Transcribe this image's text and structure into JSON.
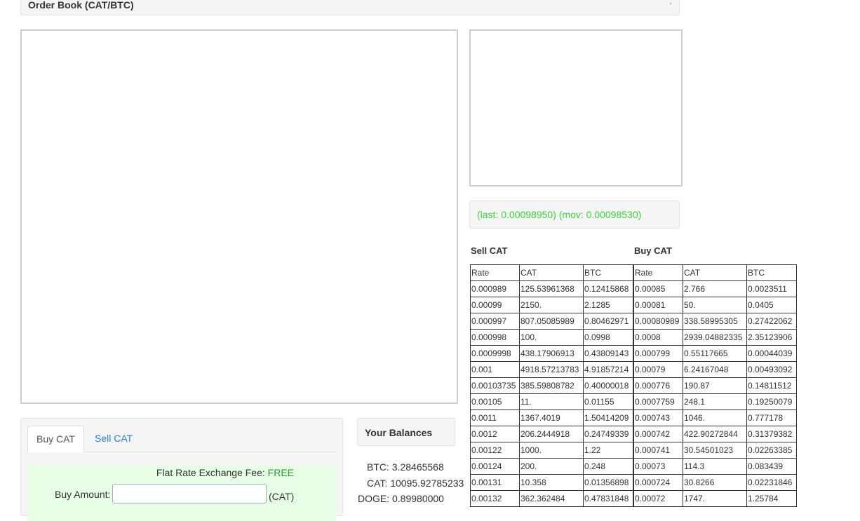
{
  "header": {
    "title": "Order Book (CAT/BTC)",
    "corner": "."
  },
  "ticker": {
    "text": "(last: 0.00098950) (mov: 0.00098530)"
  },
  "sell_book": {
    "title": "Sell CAT",
    "columns": [
      "Rate",
      "CAT",
      "BTC"
    ],
    "rows": [
      [
        "0.000989",
        "125.53961368",
        "0.12415868"
      ],
      [
        "0.00099",
        "2150.",
        "2.1285"
      ],
      [
        "0.000997",
        "807.05085989",
        "0.80462971"
      ],
      [
        "0.000998",
        "100.",
        "0.0998"
      ],
      [
        "0.0009998",
        "438.17906913",
        "0.43809143"
      ],
      [
        "0.001",
        "4918.57213783",
        "4.91857214"
      ],
      [
        "0.00103735",
        "385.59808782",
        "0.40000018"
      ],
      [
        "0.00105",
        "11.",
        "0.01155"
      ],
      [
        "0.0011",
        "1367.4019",
        "1.50414209"
      ],
      [
        "0.0012",
        "206.2444918",
        "0.24749339"
      ],
      [
        "0.00122",
        "1000.",
        "1.22"
      ],
      [
        "0.00124",
        "200.",
        "0.248"
      ],
      [
        "0.00131",
        "10.358",
        "0.01356898"
      ],
      [
        "0.00132",
        "362.362484",
        "0.47831848"
      ]
    ]
  },
  "buy_book": {
    "title": "Buy CAT",
    "columns": [
      "Rate",
      "CAT",
      "BTC"
    ],
    "rows": [
      [
        "0.00085",
        "2.766",
        "0.0023511"
      ],
      [
        "0.00081",
        "50.",
        "0.0405"
      ],
      [
        "0.00080989",
        "338.58995305",
        "0.27422062"
      ],
      [
        "0.0008",
        "2939.04882335",
        "2.35123906"
      ],
      [
        "0.000799",
        "0.55117665",
        "0.00044039"
      ],
      [
        "0.00079",
        "6.24167048",
        "0.00493092"
      ],
      [
        "0.000776",
        "190.87",
        "0.14811512"
      ],
      [
        "0.0007759",
        "248.1",
        "0.19250079"
      ],
      [
        "0.000743",
        "1046.",
        "0.777178"
      ],
      [
        "0.000742",
        "422.90272844",
        "0.31379382"
      ],
      [
        "0.000741",
        "30.54501023",
        "0.02263385"
      ],
      [
        "0.00073",
        "114.3",
        "0.083439"
      ],
      [
        "0.000724",
        "30.8266",
        "0.02231846"
      ],
      [
        "0.00072",
        "1747.",
        "1.25784"
      ]
    ]
  },
  "trade": {
    "tabs": [
      {
        "label": "Buy CAT",
        "active": true
      },
      {
        "label": "Sell CAT",
        "active": false
      }
    ],
    "fee_label": "Flat Rate Exchange Fee:",
    "fee_value": "FREE",
    "amount_label": "Buy Amount:",
    "amount_value": "",
    "amount_unit": "(CAT)"
  },
  "balances": {
    "title": "Your Balances",
    "btc": "BTC: 3.28465568",
    "cat": "CAT: 10095.92785233",
    "doge": "DOGE: 0.89980000"
  },
  "colors": {
    "ticker": "#3ecf3e",
    "link": "#2a7fc8",
    "trade_panel_bg": "#e6ffe6"
  }
}
